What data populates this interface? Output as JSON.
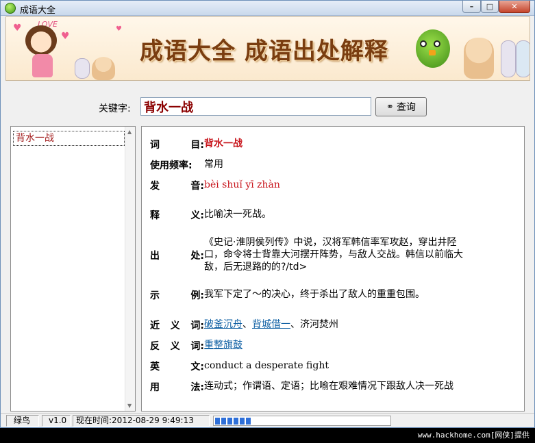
{
  "window": {
    "title": "成语大全"
  },
  "banner": {
    "title": "成语大全  成语出处解释",
    "love_text": "LOVE"
  },
  "search": {
    "label": "关键字:",
    "value": "背水一战",
    "button_label": "查询"
  },
  "list": {
    "items": [
      "背水一战"
    ]
  },
  "detail": {
    "word": {
      "label": [
        "词",
        "目"
      ],
      "value": "背水一战"
    },
    "frequency": {
      "label": "使用频率",
      "value": "常用"
    },
    "pinyin": {
      "label": [
        "发",
        "音"
      ],
      "value": "bèi shuǐ yī zhàn"
    },
    "meaning": {
      "label": [
        "释",
        "义"
      ],
      "value": "比喻决一死战。"
    },
    "source": {
      "label": [
        "出",
        "处"
      ],
      "lines": [
        "《史记·淮阴侯列传》中说，汉将军韩信率军攻赵，穿出井陉",
        "口，命令将士背靠大河摆开阵势，与敌人交战。韩信以前临大",
        "敌，后无退路的的?/td>"
      ]
    },
    "example": {
      "label": [
        "示",
        "例"
      ],
      "value": "我军下定了～的决心，终于杀出了敌人的重重包围。"
    },
    "synonyms": {
      "label": [
        "近",
        "义",
        "词"
      ],
      "links": [
        "破釜沉舟",
        "背城借一"
      ],
      "sep": "、",
      "plain": "济河焚州"
    },
    "antonyms": {
      "label": [
        "反",
        "义",
        "词"
      ],
      "links": [
        "重整旗鼓"
      ]
    },
    "english": {
      "label": [
        "英",
        "文"
      ],
      "value": "conduct a desperate fight"
    },
    "usage": {
      "label": [
        "用",
        "法"
      ],
      "value": "连动式；作谓语、定语；比喻在艰难情况下跟敌人决一死战"
    },
    "colon": ":"
  },
  "status": {
    "name": "绿鸟",
    "version": "v1.0",
    "time": "现在时间:2012-08-29 9:49:13",
    "progress_blocks": 6
  },
  "footer": {
    "watermark": "www.hackhome.com[网侠]提供"
  },
  "colors": {
    "accent_red": "#c8161d",
    "link_blue": "#0e5fa3",
    "progress_blue": "#2e6fd8"
  }
}
